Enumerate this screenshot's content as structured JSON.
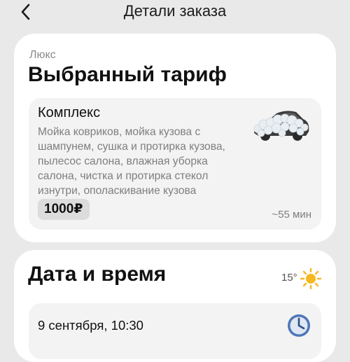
{
  "header": {
    "title": "Детали заказа",
    "back_icon": "chevron-left-icon"
  },
  "tariff_card": {
    "category": "Люкс",
    "title": "Выбранный тариф",
    "tariff": {
      "name": "Комплекс",
      "description": "Мойка ковриков, мойка кузова с шампунем, сушка и протирка кузова, пылесос салона, влажная уборка салона, чистка и протирка стекол изнутри, ополаскивание кузова",
      "price": "1000₽",
      "duration": "~55 мин",
      "image_icon": "foam-car-icon"
    }
  },
  "datetime_card": {
    "title": "Дата и время",
    "weather": {
      "temperature": "15°",
      "icon": "sun-icon",
      "icon_color": "#f5b820"
    },
    "value": "9 сентября, 10:30",
    "clock_icon": "clock-icon",
    "clock_color": "#4f76b8"
  }
}
